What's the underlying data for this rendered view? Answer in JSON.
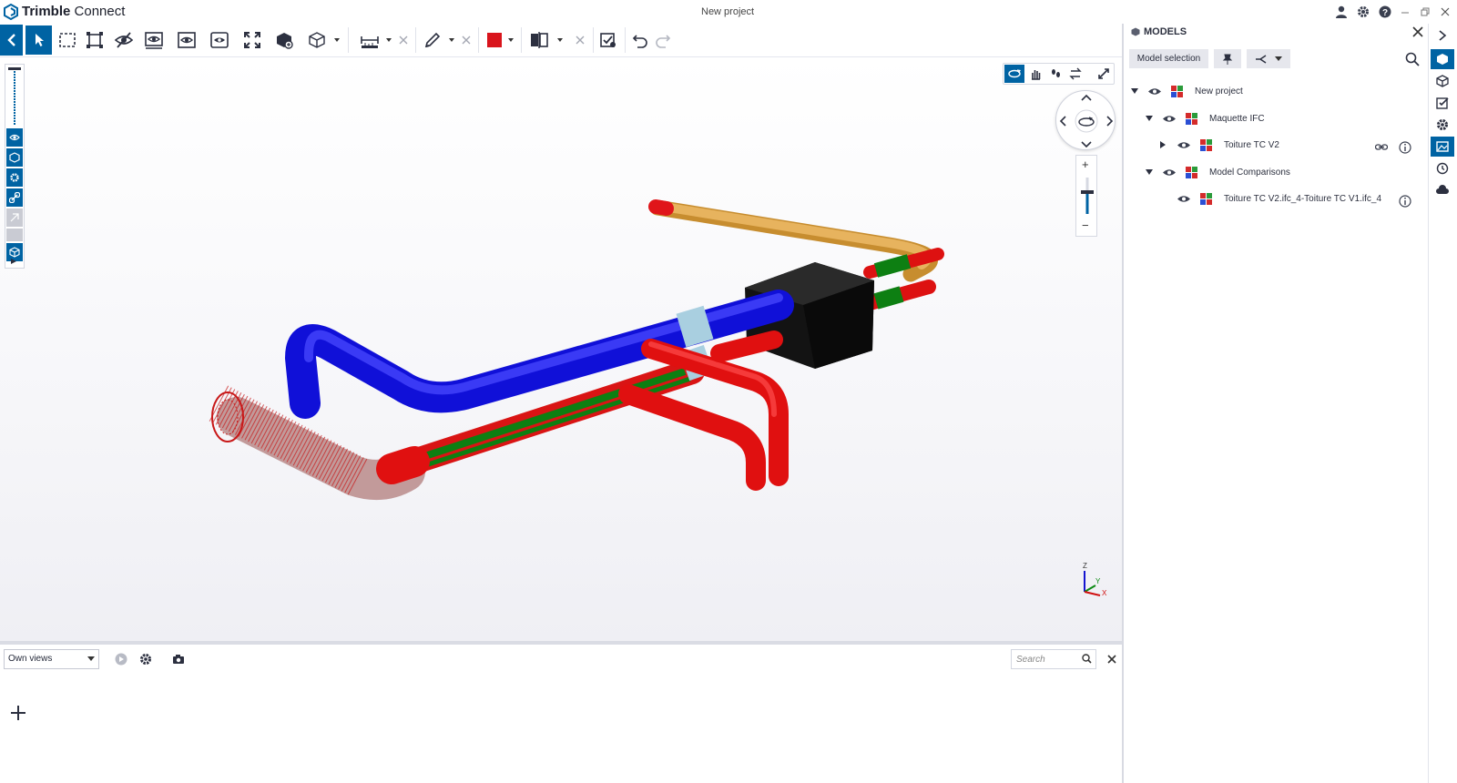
{
  "app": {
    "name_bold": "Trimble",
    "name_rest": " Connect",
    "project_title": "New project"
  },
  "colors": {
    "accent": "#0063a3",
    "pipe_blue": "#1a1ae6",
    "pipe_red": "#e60f0f",
    "pipe_green": "#0d8a14",
    "pipe_orange": "#e0a84a",
    "pipe_lightblue": "#a9cfe0",
    "unit_black": "#111111"
  },
  "toolbar": {
    "tools": [
      "back-icon",
      "select-icon",
      "box-select-icon",
      "fit-selection-icon",
      "hide-icon",
      "isolate-icon",
      "section-view-icon",
      "show-all-icon",
      "fit-all-icon",
      "object-properties-icon",
      "view-cube-icon",
      "measure-icon",
      "clear-measure-icon",
      "markup-pen-icon",
      "clear-markup-icon",
      "color-swatch-icon",
      "section-plane-icon",
      "clear-section-icon",
      "clash-check-icon",
      "undo-icon",
      "redo-icon"
    ]
  },
  "viewport": {
    "nav_modes": [
      "orbit-icon",
      "pan-icon",
      "walk-icon",
      "swap-icon",
      "fullscreen-icon"
    ],
    "zoom": {
      "plus": "+",
      "minus": "−"
    },
    "axis": {
      "z": "Z",
      "y": "Y",
      "x": "X"
    }
  },
  "views_panel": {
    "selected_view": "Own views",
    "search_placeholder": "Search",
    "add_label": "+"
  },
  "models_panel": {
    "title": "MODELS",
    "model_selection_label": "Model selection",
    "tree": [
      {
        "label": "New project",
        "level": 0,
        "expanded": true
      },
      {
        "label": "Maquette IFC",
        "level": 1,
        "expanded": true
      },
      {
        "label": "Toiture TC V2",
        "level": 2,
        "expanded": false
      },
      {
        "label": "Model Comparisons",
        "level": 1,
        "expanded": true
      },
      {
        "label": "Toiture TC V2.ifc_4-Toiture TC V1.ifc_4",
        "level": 2,
        "expanded": false
      }
    ]
  },
  "right_rail": {
    "items": [
      "expand-icon",
      "models-icon",
      "cube-icon",
      "todo-icon",
      "settings-gear-icon",
      "views-icon",
      "history-icon",
      "cloud-icon"
    ]
  }
}
